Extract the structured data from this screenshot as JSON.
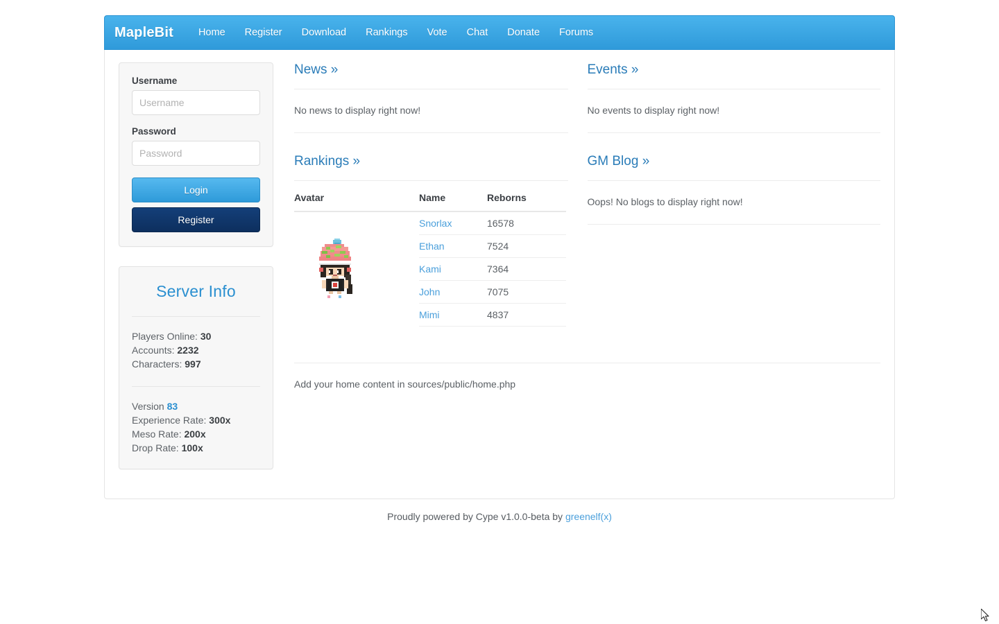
{
  "navbar": {
    "brand": "MapleBit",
    "links": [
      {
        "label": "Home"
      },
      {
        "label": "Register"
      },
      {
        "label": "Download"
      },
      {
        "label": "Rankings"
      },
      {
        "label": "Vote"
      },
      {
        "label": "Chat"
      },
      {
        "label": "Donate"
      },
      {
        "label": "Forums"
      }
    ]
  },
  "login": {
    "username_label": "Username",
    "username_placeholder": "Username",
    "username_value": "",
    "password_label": "Password",
    "password_placeholder": "Password",
    "password_value": "",
    "login_button": "Login",
    "register_button": "Register"
  },
  "server_info": {
    "title": "Server Info",
    "players_online_label": "Players Online:",
    "players_online_value": "30",
    "accounts_label": "Accounts:",
    "accounts_value": "2232",
    "characters_label": "Characters:",
    "characters_value": "997",
    "version_label": "Version",
    "version_value": "83",
    "experience_label": "Experience Rate:",
    "experience_value": "300x",
    "meso_label": "Meso Rate:",
    "meso_value": "200x",
    "drop_label": "Drop Rate:",
    "drop_value": "100x"
  },
  "news": {
    "title": "News",
    "chevron": "»",
    "empty_text": "No news to display right now!"
  },
  "events": {
    "title": "Events",
    "chevron": "»",
    "empty_text": "No events to display right now!"
  },
  "rankings": {
    "title": "Rankings",
    "chevron": "»",
    "columns": [
      "Avatar",
      "Name",
      "Reborns"
    ],
    "rows": [
      {
        "name": "Snorlax",
        "reborns": "16578"
      },
      {
        "name": "Ethan",
        "reborns": "7524"
      },
      {
        "name": "Kami",
        "reborns": "7364"
      },
      {
        "name": "John",
        "reborns": "7075"
      },
      {
        "name": "Mimi",
        "reborns": "4837"
      }
    ],
    "avatar_alt": "character-avatar"
  },
  "gm_blog": {
    "title": "GM Blog",
    "chevron": "»",
    "empty_text": "Oops! No blogs to display right now!"
  },
  "home_note": "Add your home content in sources/public/home.php",
  "footer": {
    "text": "Proudly powered by Cype v1.0.0-beta by",
    "link": "greenelf(x)"
  },
  "colors": {
    "navbar_top": "#49b3ec",
    "navbar_bottom": "#2f9ada",
    "link_blue": "#4a9fdb",
    "heading_blue": "#2a7cb8",
    "panel_bg": "#f7f7f7",
    "register_navy": "#143f79"
  }
}
